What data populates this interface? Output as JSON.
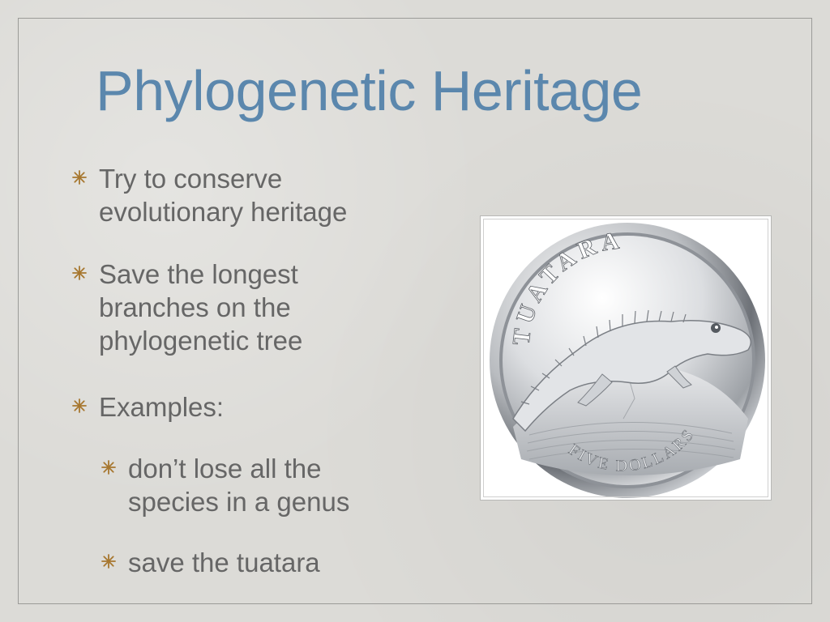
{
  "slide": {
    "title": "Phylogenetic Heritage",
    "bullets": [
      {
        "level": 1,
        "text": "Try to conserve evolutionary heritage"
      },
      {
        "level": 1,
        "text": "Save the longest branches on the phylogenetic tree"
      },
      {
        "level": 1,
        "text": "Examples:"
      },
      {
        "level": 2,
        "text": "don’t lose all the species in a genus"
      },
      {
        "level": 2,
        "text": "save the tuatara"
      }
    ],
    "coin_image": {
      "top_text": "TUATARA",
      "bottom_text": "FIVE DOLLARS"
    }
  },
  "colors": {
    "background": "#dcdbd7",
    "title": "#5b87ad",
    "body_text": "#666666",
    "bullet_marker": "#a7772f"
  }
}
